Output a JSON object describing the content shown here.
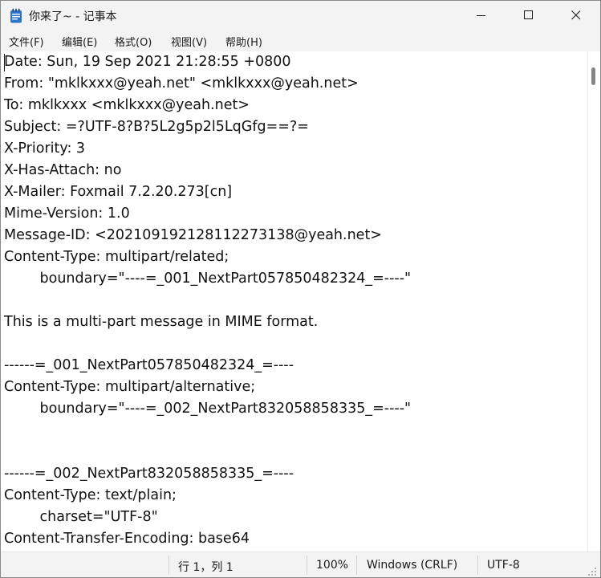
{
  "window": {
    "title": "你来了~ - 记事本"
  },
  "menu": [
    "文件(F)",
    "编辑(E)",
    "格式(O)",
    "视图(V)",
    "帮助(H)"
  ],
  "document": {
    "text": "Date: Sun, 19 Sep 2021 21:28:55 +0800\nFrom: \"mklkxxx@yeah.net\" <mklkxxx@yeah.net>\nTo: mklkxxx <mklkxxx@yeah.net>\nSubject: =?UTF-8?B?5L2g5p2l5LqGfg==?=\nX-Priority: 3\nX-Has-Attach: no\nX-Mailer: Foxmail 7.2.20.273[cn]\nMime-Version: 1.0\nMessage-ID: <202109192128112273138@yeah.net>\nContent-Type: multipart/related;\n\tboundary=\"----=_001_NextPart057850482324_=----\"\n\nThis is a multi-part message in MIME format.\n\n------=_001_NextPart057850482324_=----\nContent-Type: multipart/alternative;\n\tboundary=\"----=_002_NextPart832058858335_=----\"\n\n\n------=_002_NextPart832058858335_=----\nContent-Type: text/plain;\n\tcharset=\"UTF-8\"\nContent-Transfer-Encoding: base64"
  },
  "status": {
    "position": "行 1，列 1",
    "zoom": "100%",
    "line_ending": "Windows (CRLF)",
    "encoding": "UTF-8"
  },
  "icons": {
    "app": "notepad-icon",
    "minimize": "minimize-icon",
    "maximize": "maximize-icon",
    "close": "close-icon",
    "grip": "resize-grip-icon"
  },
  "colors": {
    "chrome": "#f3f3f3",
    "app_icon_blue": "#2f74c9",
    "text": "#111111"
  }
}
